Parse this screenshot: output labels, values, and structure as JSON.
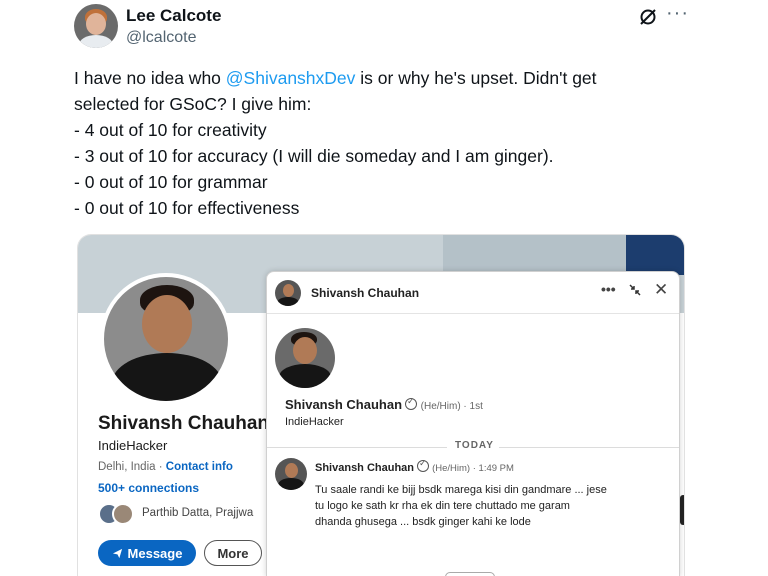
{
  "tweet": {
    "author_name": "Lee Calcote",
    "author_handle": "@lcalcote",
    "grok_icon": "grok-slash-circle-icon",
    "more_icon": "more-horizontal-icon",
    "text_lines": {
      "l1_prefix": "I have no idea who ",
      "l1_mention": "@ShivanshxDev",
      "l1_suffix": " is or why he's upset. Didn't get",
      "l2": "selected for GSoC? I give him:",
      "l3": "- 4 out of 10 for creativity",
      "l4": "- 3 out of 10 for accuracy (I will die someday and I am ginger).",
      "l5": "- 0 out of 10 for grammar",
      "l6": "- 0 out of 10 for effectiveness"
    }
  },
  "linkedin": {
    "name": "Shivansh Chauhan",
    "headline": "IndieHacker",
    "location": "Delhi, India · ",
    "contact_info": "Contact info",
    "connections": "500+ connections",
    "mutual": "Parthib Datta, Prajjwa",
    "message_button": "Message",
    "more_button": "More"
  },
  "chat": {
    "title": "Shivansh Chauhan",
    "dots": "•••",
    "collapse_icon": "collapse-arrows-icon",
    "close": "✕",
    "profile_name": "Shivansh Chauhan",
    "profile_pronoun": "(He/Him) · 1st",
    "profile_headline": "IndieHacker",
    "today_label": "TODAY",
    "message": {
      "sender": "Shivansh Chauhan",
      "meta": "(He/Him) · 1:49 PM",
      "lines": {
        "l1": "Tu saale randi ke bijj bsdk marega kisi din gandmare ... jese",
        "l2": "tu logo ke sath kr rha ek din tere chuttado me garam",
        "l3": "dhanda ghusega ... bsdk ginger kahi ke lode"
      }
    }
  }
}
